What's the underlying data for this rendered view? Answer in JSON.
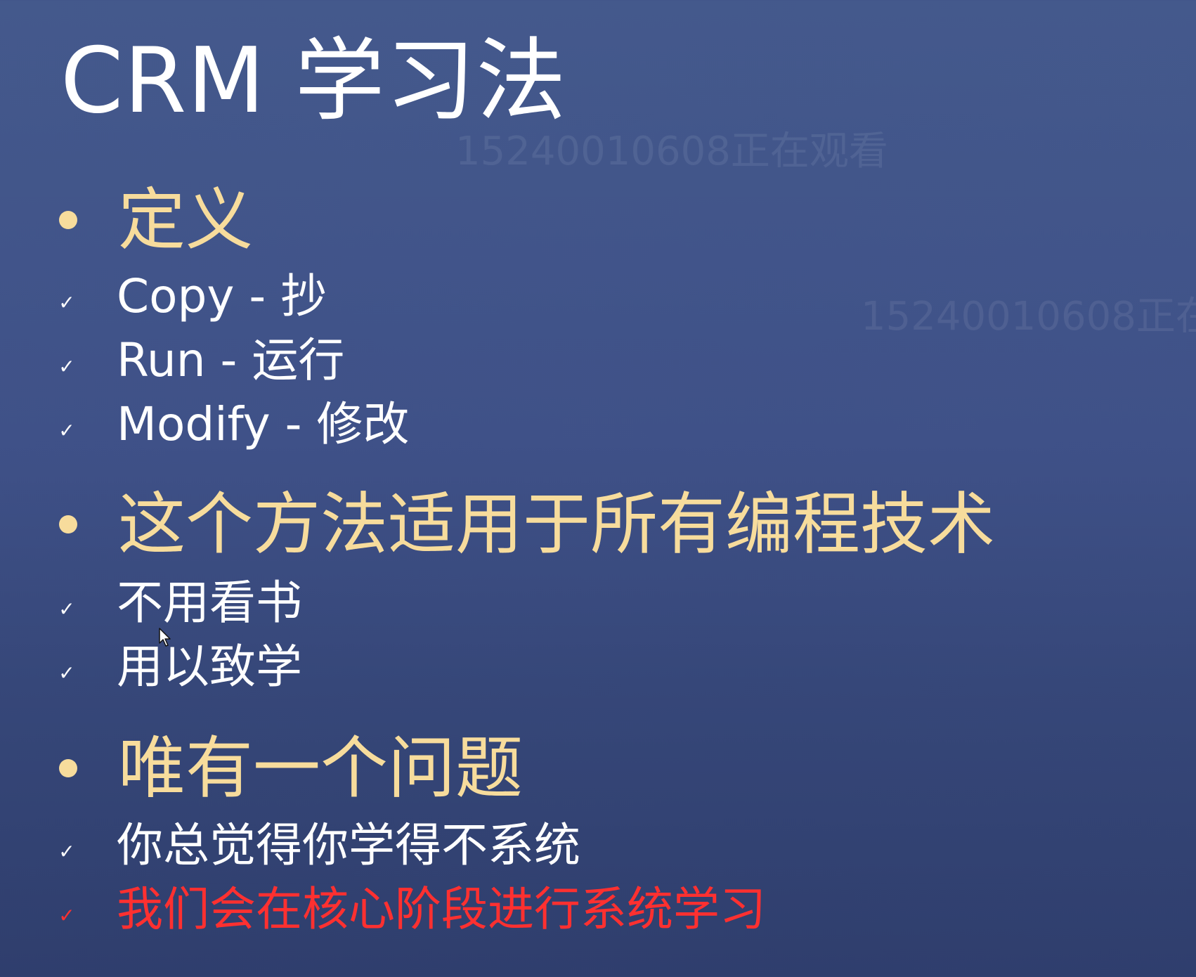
{
  "title": "CRM 学习法",
  "watermarks": [
    "15240010608正在观看",
    "15240010608正在"
  ],
  "colors": {
    "heading": "#f7dc9c",
    "item": "#ffffff",
    "highlight": "#ff3030",
    "background_top": "#44598c",
    "background_bottom": "#2f3e6d"
  },
  "sections": [
    {
      "heading": "定义",
      "items": [
        "Copy - 抄",
        "Run - 运行",
        "Modify - 修改"
      ]
    },
    {
      "heading": "这个方法适用于所有编程技术",
      "items": [
        "不用看书",
        "用以致学"
      ]
    },
    {
      "heading": "唯有一个问题",
      "items": [
        "你总觉得你学得不系统",
        "我们会在核心阶段进行系统学习"
      ]
    }
  ],
  "icons": {
    "bullet": "bullet-dot-icon",
    "check": "check-icon",
    "cursor": "mouse-pointer-icon"
  }
}
